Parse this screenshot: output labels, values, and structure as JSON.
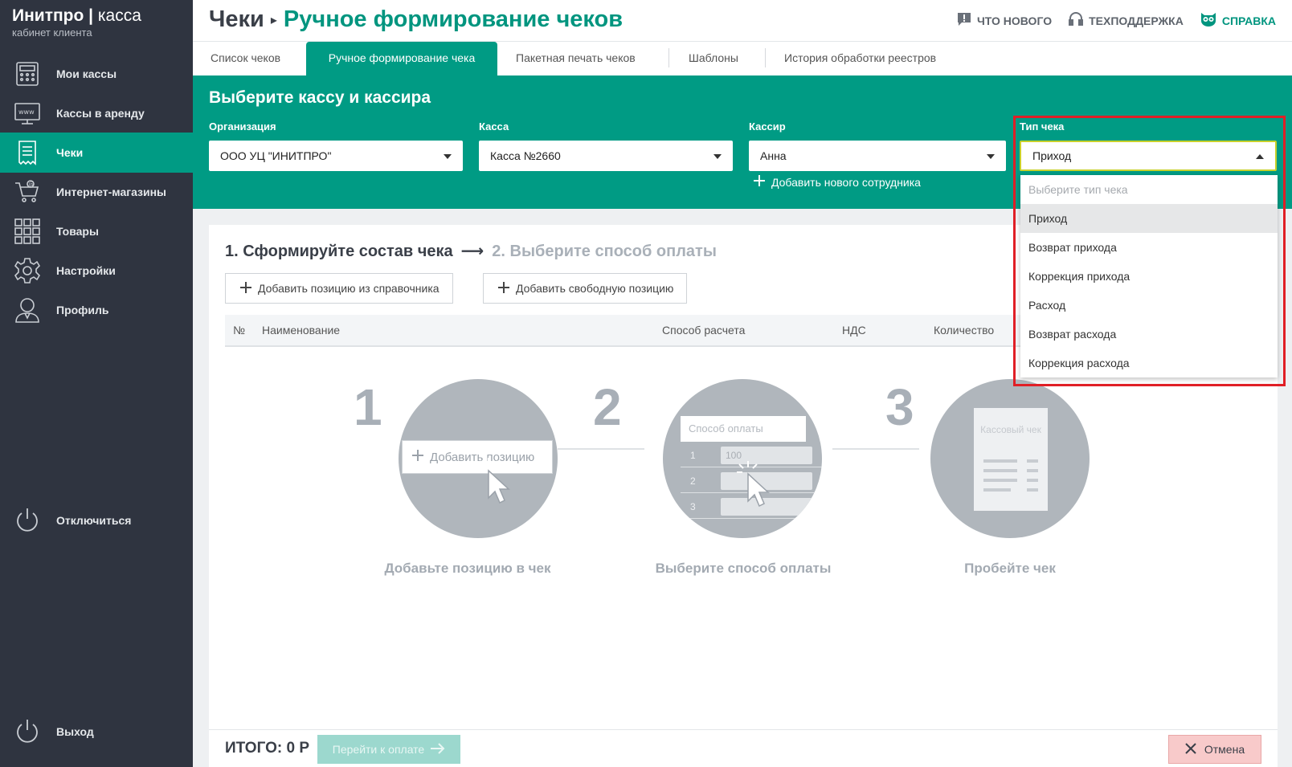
{
  "brand": {
    "name": "Инитпро",
    "product": "касса",
    "subtitle": "кабинет клиента"
  },
  "sidebar": {
    "items": [
      {
        "label": "Мои кассы",
        "icon": "cash-register-icon"
      },
      {
        "label": "Кассы в аренду",
        "icon": "www-terminal-icon"
      },
      {
        "label": "Чеки",
        "icon": "receipt-icon",
        "active": true
      },
      {
        "label": "Интернет-магазины",
        "icon": "cart-icon"
      },
      {
        "label": "Товары",
        "icon": "grid-icon"
      },
      {
        "label": "Настройки",
        "icon": "gear-icon"
      },
      {
        "label": "Профиль",
        "icon": "user-icon"
      }
    ],
    "disconnect_label": "Отключиться",
    "logout_label": "Выход"
  },
  "header": {
    "section": "Чеки",
    "page": "Ручное формирование чеков",
    "links": {
      "news": "ЧТО НОВОГО",
      "support": "ТЕХПОДДЕРЖКА",
      "help": "СПРАВКА"
    }
  },
  "tabs": [
    {
      "label": "Список чеков"
    },
    {
      "label": "Ручное формирование чека",
      "active": true
    },
    {
      "label": "Пакетная печать чеков"
    },
    {
      "label": "Шаблоны"
    },
    {
      "label": "История обработки реестров"
    }
  ],
  "panel": {
    "title": "Выберите кассу и кассира",
    "organization": {
      "label": "Организация",
      "value": "ООО УЦ \"ИНИТПРО\""
    },
    "register": {
      "label": "Касса",
      "value": "Касса №2660"
    },
    "cashier": {
      "label": "Кассир",
      "value": "Анна"
    },
    "add_employee": "Добавить нового сотрудника",
    "receipt_type": {
      "label": "Тип чека",
      "value": "Приход",
      "placeholder": "Выберите тип чека",
      "options": [
        "Приход",
        "Возврат прихода",
        "Коррекция прихода",
        "Расход",
        "Возврат расхода",
        "Коррекция расхода"
      ]
    }
  },
  "main": {
    "step1_title": "1. Сформируйте состав чека",
    "step2_title": "2. Выберите способ оплаты",
    "add_from_catalog": "Добавить позицию из справочника",
    "add_free": "Добавить свободную позицию",
    "columns": {
      "num": "№",
      "name": "Наименование",
      "payment_method": "Способ расчета",
      "vat": "НДС",
      "quantity": "Количество"
    },
    "steps": [
      {
        "num": "1",
        "caption": "Добавьте позицию в чек",
        "illustration_text": "Добавить позицию"
      },
      {
        "num": "2",
        "caption": "Выберите способ оплаты",
        "illustration_text": "Способ оплаты",
        "rows": [
          "1",
          "2",
          "3"
        ],
        "row_value": "100"
      },
      {
        "num": "3",
        "caption": "Пробейте чек",
        "illustration_text": "Кассовый чек"
      }
    ]
  },
  "footer": {
    "total": "ИТОГО: 0 Р",
    "pay_label": "Перейти к оплате",
    "cancel_label": "Отмена"
  },
  "colors": {
    "accent": "#009b84",
    "sidebar": "#2f3440",
    "highlight": "#e01f26"
  }
}
